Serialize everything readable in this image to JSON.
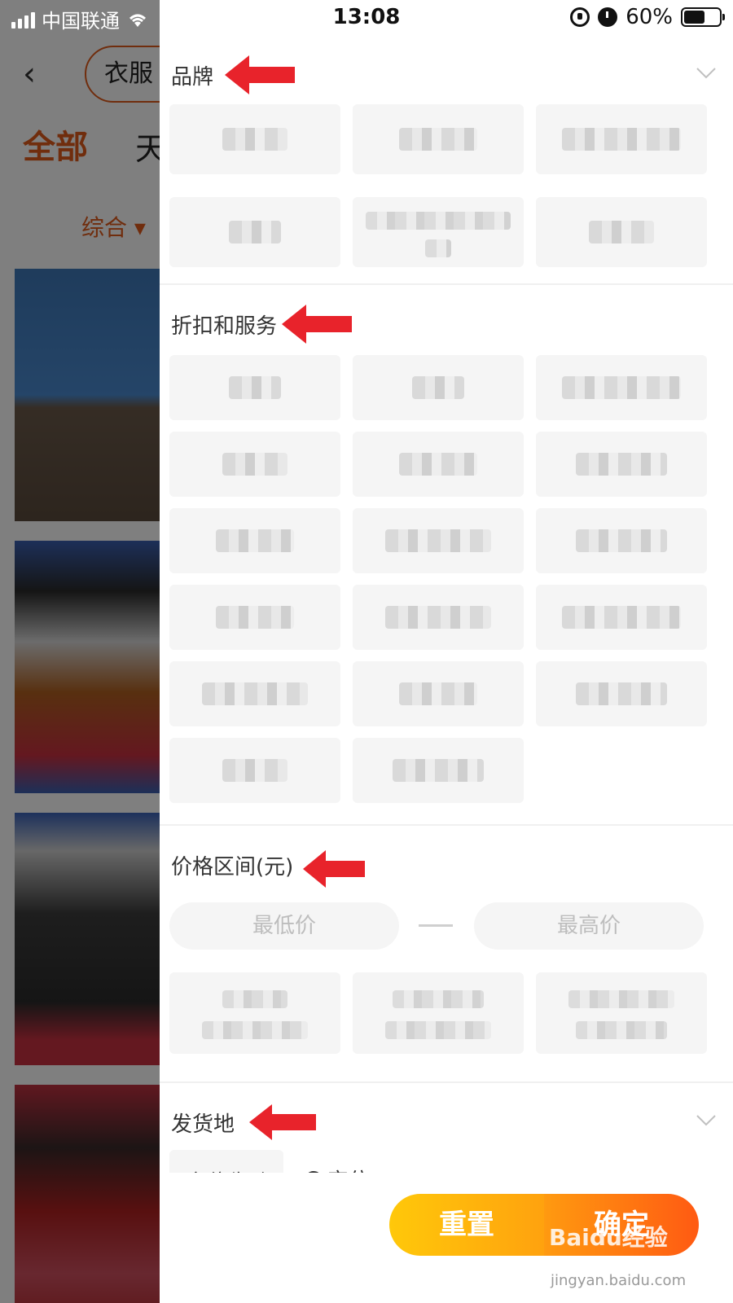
{
  "status_bar": {
    "carrier": "中国联通",
    "time": "13:08",
    "battery": "60%",
    "battery_level": 0.6
  },
  "background_app": {
    "search_text": "衣服",
    "tab_all": "全部",
    "tab_second": "天",
    "sort_label": "综合"
  },
  "filter": {
    "brand": {
      "title": "品牌",
      "chevron_icon": "chevron-down-icon",
      "items": [
        "",
        "",
        "",
        "",
        "",
        ""
      ]
    },
    "discount": {
      "title": "折扣和服务",
      "items": [
        "",
        "",
        "",
        "",
        "",
        "",
        "",
        "",
        "",
        "",
        "",
        "",
        "",
        "",
        "",
        "",
        ""
      ]
    },
    "price": {
      "title": "价格区间(元)",
      "min_placeholder": "最低价",
      "max_placeholder": "最高价",
      "presets": [
        "",
        "",
        ""
      ]
    },
    "ship_from": {
      "title": "发货地",
      "chevron_icon": "chevron-down-icon",
      "current": "定位失败",
      "locate_label": "定位"
    }
  },
  "actions": {
    "reset": "重置",
    "confirm": "确定"
  },
  "annotation_color": "#e8232b",
  "accent_color": "#ff5a12",
  "watermark": {
    "logo": "Baidu经验",
    "url": "jingyan.baidu.com"
  }
}
